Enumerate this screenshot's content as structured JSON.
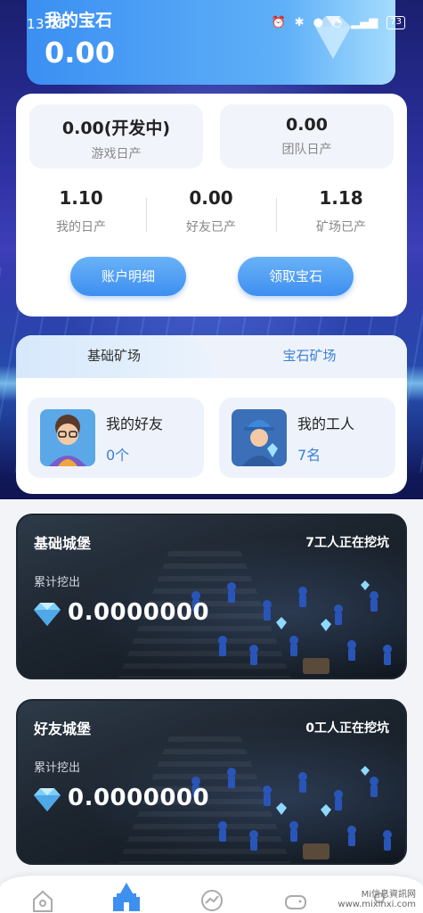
{
  "status": {
    "time": "13:15",
    "battery": "73",
    "icons": [
      "alarm-icon",
      "bluetooth-icon",
      "location-icon",
      "wifi-icon",
      "signal-icon",
      "battery-icon"
    ]
  },
  "gems": {
    "title": "我的宝石",
    "amount": "0.00"
  },
  "stats": {
    "game_daily": {
      "value": "0.00(开发中)",
      "label": "游戏日产"
    },
    "team_daily": {
      "value": "0.00",
      "label": "团队日产"
    },
    "my_daily": {
      "value": "1.10",
      "label": "我的日产"
    },
    "friend_produced": {
      "value": "0.00",
      "label": "好友已产"
    },
    "mine_produced": {
      "value": "1.18",
      "label": "矿场已产"
    },
    "btn_account": "账户明细",
    "btn_claim": "领取宝石"
  },
  "mine": {
    "tabs": [
      {
        "label": "基础矿场",
        "active": true
      },
      {
        "label": "宝石矿场",
        "active": false
      }
    ],
    "friends": {
      "title": "我的好友",
      "count": "0个"
    },
    "workers": {
      "title": "我的工人",
      "count": "7名"
    }
  },
  "castles": [
    {
      "name": "基础城堡",
      "workers": "7工人正在挖坑",
      "acc_label": "累计挖出",
      "value": "0.0000000"
    },
    {
      "name": "好友城堡",
      "workers": "0工人正在挖坑",
      "acc_label": "累计挖出",
      "value": "0.0000000"
    }
  ],
  "nav": {
    "items": [
      "home-icon",
      "castle-icon",
      "chart-icon",
      "game-icon",
      "profile-icon"
    ],
    "active": "castle-icon"
  },
  "watermark": {
    "line1": "Mi信息資訊网",
    "line2": "www.mixinxi.com"
  },
  "colors": {
    "accent": "#3d8ff0",
    "accent_text": "#3b7fd8",
    "card_bg": "#eef3fb"
  }
}
